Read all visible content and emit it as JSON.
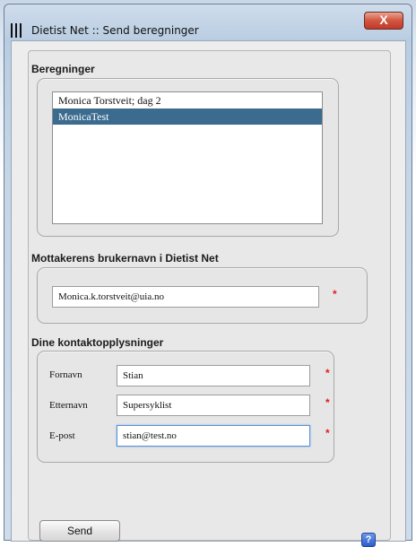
{
  "window": {
    "title": "Dietist Net :: Send beregninger",
    "close_symbol": "X"
  },
  "calculations": {
    "heading": "Beregninger",
    "items": [
      {
        "label": "Monica Torstveit; dag 2",
        "selected": false
      },
      {
        "label": "MonicaTest",
        "selected": true
      }
    ]
  },
  "recipient": {
    "heading": "Mottakerens brukernavn i Dietist Net",
    "username_value": "Monica.k.torstveit@uia.no",
    "required_mark": "*"
  },
  "contact": {
    "heading": "Dine kontaktopplysninger",
    "fields": [
      {
        "label": "Fornavn",
        "value": "Stian",
        "required_mark": "*"
      },
      {
        "label": "Etternavn",
        "value": "Supersyklist",
        "required_mark": "*"
      },
      {
        "label": "E-post",
        "value": "stian@test.no",
        "required_mark": "*"
      }
    ]
  },
  "footer": {
    "send_label": "Send",
    "help_symbol": "?"
  },
  "colors": {
    "selected_row": "#3b6b8e",
    "required_asterisk": "#e02020",
    "help_button": "#2c5fc8"
  }
}
